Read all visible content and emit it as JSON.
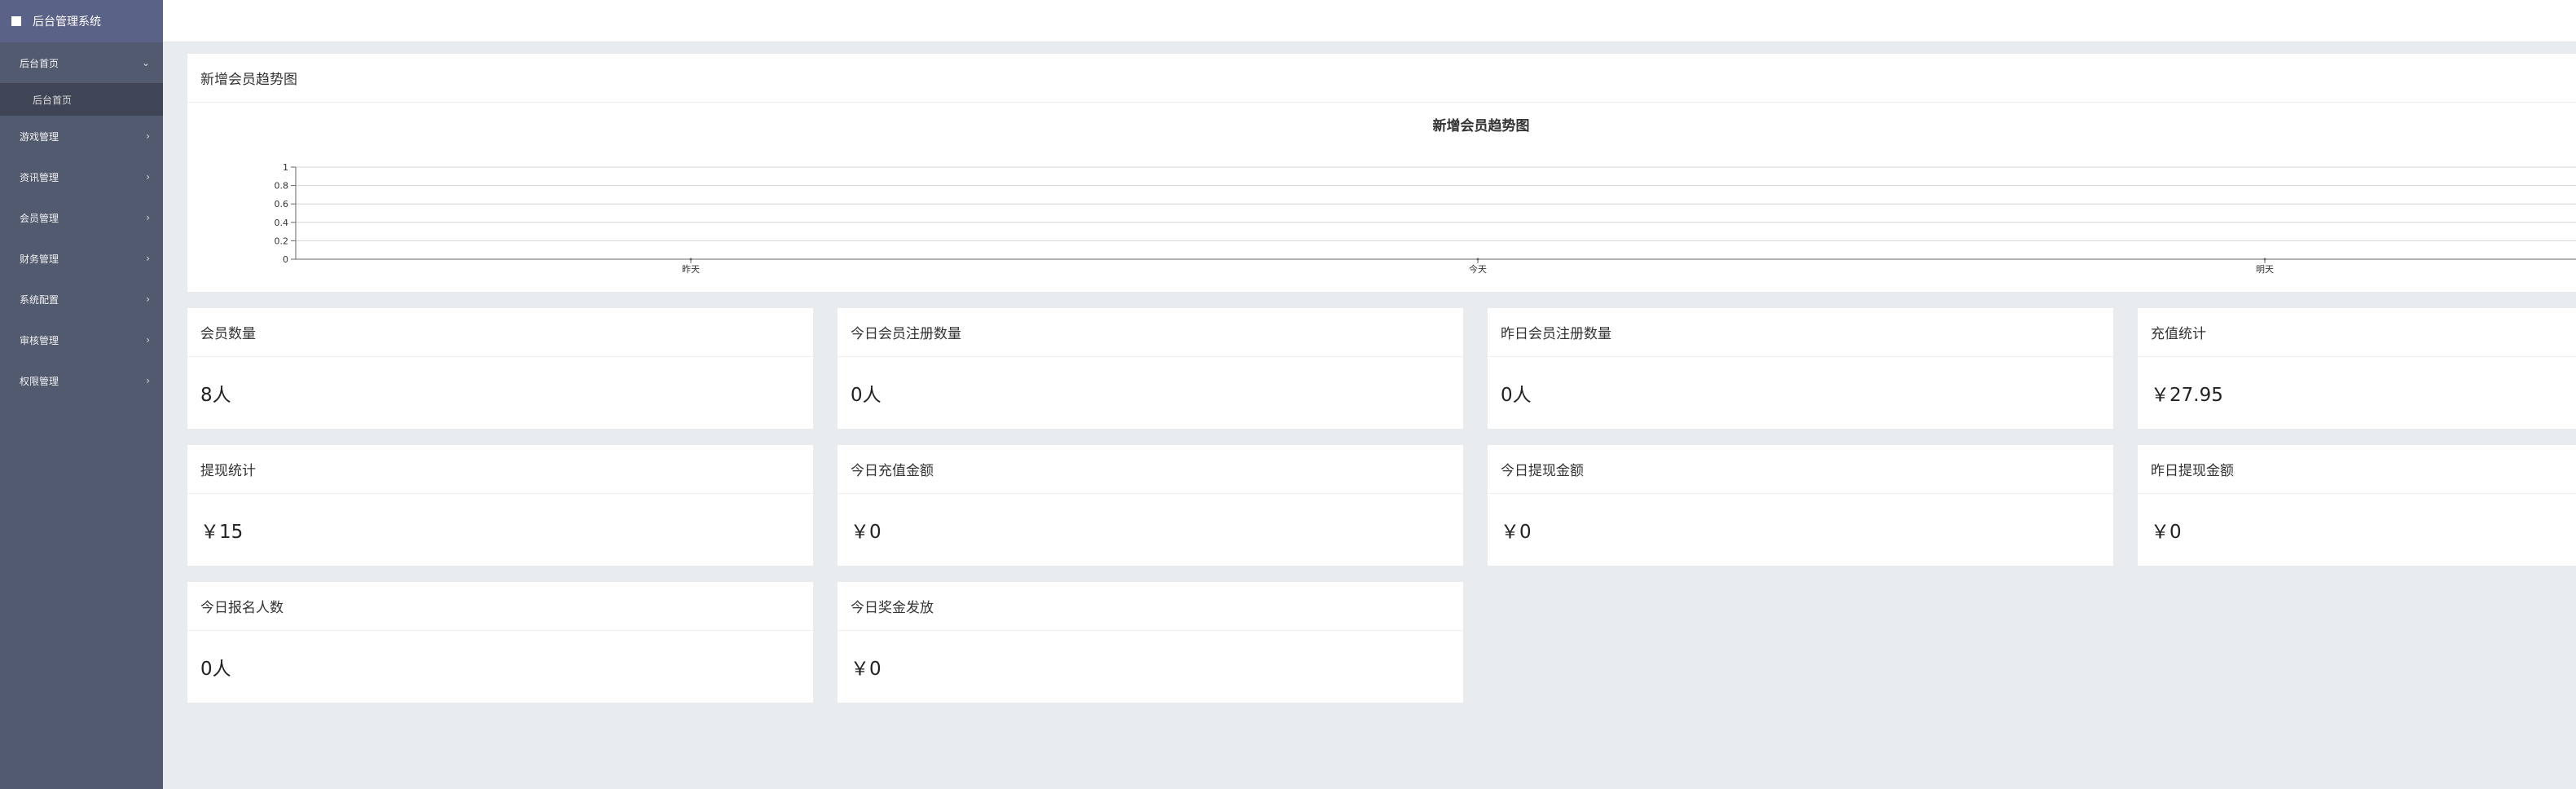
{
  "brand": {
    "title": "后台管理系统"
  },
  "sidebar": {
    "items": [
      {
        "label": "后台首页",
        "expanded": true,
        "children": [
          {
            "label": "后台首页"
          }
        ]
      },
      {
        "label": "游戏管理"
      },
      {
        "label": "资讯管理"
      },
      {
        "label": "会员管理"
      },
      {
        "label": "财务管理"
      },
      {
        "label": "系统配置"
      },
      {
        "label": "审核管理"
      },
      {
        "label": "权限管理"
      }
    ]
  },
  "chart_panel": {
    "header": "新增会员趋势图"
  },
  "chart_data": {
    "type": "line",
    "title": "新增会员趋势图",
    "categories": [
      "昨天",
      "今天",
      "明天"
    ],
    "series": [
      {
        "values": [
          0,
          0,
          0
        ]
      }
    ],
    "yticks": [
      "0",
      "0.2",
      "0.4",
      "0.6",
      "0.8",
      "1"
    ],
    "ylim": [
      0,
      1
    ],
    "grid": true
  },
  "stats": {
    "member_count": {
      "label": "会员数量",
      "value": "8人"
    },
    "today_register": {
      "label": "今日会员注册数量",
      "value": "0人"
    },
    "yesterday_register": {
      "label": "昨日会员注册数量",
      "value": "0人"
    },
    "recharge_total": {
      "label": "充值统计",
      "value": "￥27.95"
    },
    "withdraw_total": {
      "label": "提现统计",
      "value": "￥15"
    },
    "today_recharge": {
      "label": "今日充值金额",
      "value": "￥0"
    },
    "today_withdraw": {
      "label": "今日提现金额",
      "value": "￥0"
    },
    "yesterday_withdraw": {
      "label": "昨日提现金额",
      "value": "￥0"
    },
    "today_signups": {
      "label": "今日报名人数",
      "value": "0人"
    },
    "today_bonus": {
      "label": "今日奖金发放",
      "value": "￥0"
    }
  },
  "colors": {
    "sidebar_bg": "#525a6f",
    "brand_bg": "#5b6287",
    "submenu_bg": "#3f4556",
    "page_bg": "#e9ecef"
  }
}
